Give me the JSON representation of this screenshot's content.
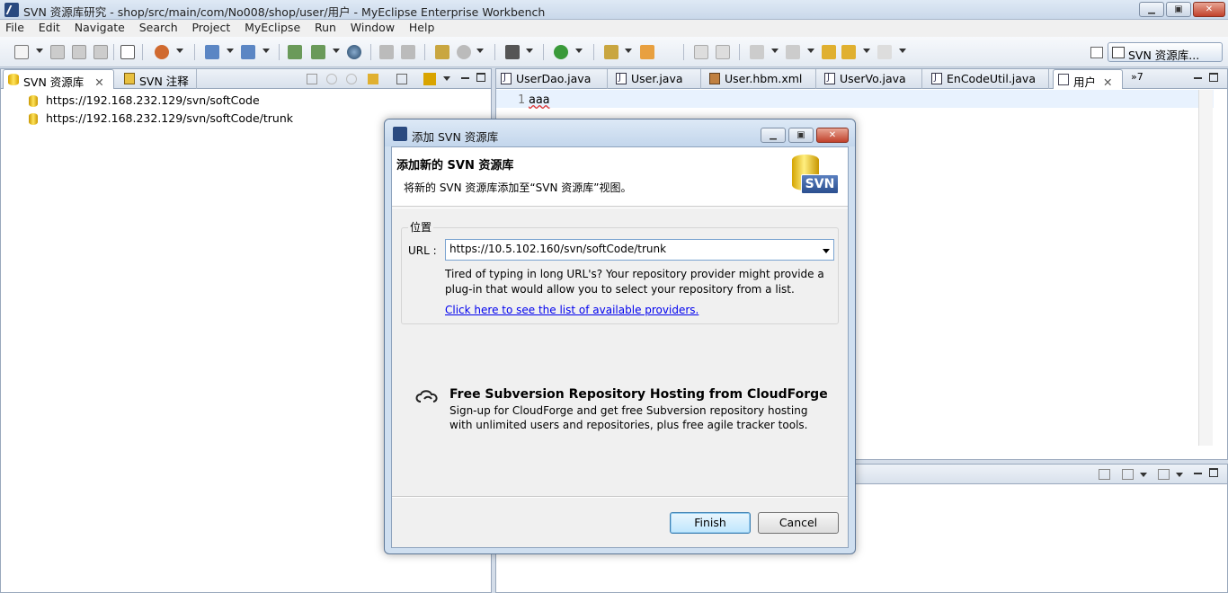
{
  "window": {
    "title": "SVN 资源库研究 - shop/src/main/com/No008/shop/user/用户 - MyEclipse Enterprise Workbench",
    "min_label": "▁",
    "max_label": "▣",
    "close_label": "✕"
  },
  "menu": [
    "File",
    "Edit",
    "Navigate",
    "Search",
    "Project",
    "MyEclipse",
    "Run",
    "Window",
    "Help"
  ],
  "toolbar": {
    "perspective_label": "SVN 资源库..."
  },
  "left_panel": {
    "tabs": [
      {
        "label": "SVN 资源库",
        "close": "✕"
      },
      {
        "label": "SVN 注释"
      }
    ],
    "tree": [
      "https://192.168.232.129/svn/softCode",
      "https://192.168.232.129/svn/softCode/trunk"
    ]
  },
  "editor": {
    "tabs": [
      "UserDao.java",
      "User.java",
      "User.hbm.xml",
      "UserVo.java",
      "EnCodeUtil.java",
      "用户"
    ],
    "active_close": "✕",
    "overflow": "»7",
    "line_number": "1",
    "line_text": "aaa"
  },
  "dialog": {
    "title": "添加 SVN 资源库",
    "heading": "添加新的 SVN 资源库",
    "description": "将新的 SVN 资源库添加至“SVN 资源库”视图。",
    "logo_text": "SVN",
    "group_label": "位置",
    "url_label": "URL :",
    "url_value": "https://10.5.102.160/svn/softCode/trunk",
    "hint_line1": "Tired of typing in long URL's?  Your repository provider might provide a",
    "hint_line2": "plug-in that would allow you to select your repository from a list.",
    "providers_link": "Click here to see the list of available providers.",
    "cloudforge_title": "Free Subversion Repository Hosting from CloudForge",
    "cloudforge_line1": "Sign-up for CloudForge and get free Subversion repository hosting",
    "cloudforge_line2": "with unlimited users and repositories, plus free agile tracker tools.",
    "finish_label": "Finish",
    "cancel_label": "Cancel"
  }
}
